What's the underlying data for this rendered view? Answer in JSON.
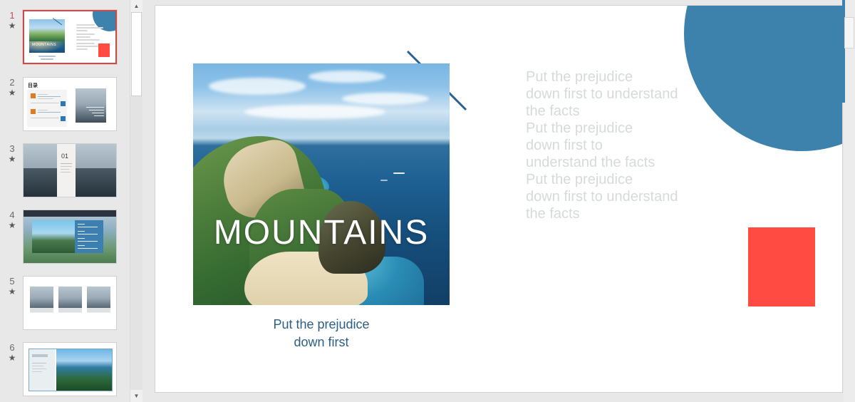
{
  "app": {
    "name": "presentation-editor",
    "accent_blue": "#3c82ad",
    "accent_red": "#ff4b42",
    "caption_blue": "#2c5f86",
    "body_text_gray": "#d6dadd",
    "selection_border": "#c0504d",
    "canvas_bg": "#ffffff",
    "workspace_bg": "#e8e8e8"
  },
  "thumbnail_panel": {
    "name": "slide-thumbnail-panel",
    "animation_marker": "★",
    "slides": [
      {
        "number": "1",
        "star": "★",
        "selected": true,
        "title": "title-slide-mountains"
      },
      {
        "number": "2",
        "star": "★",
        "selected": false,
        "title": "contents-slide",
        "heading": "目录"
      },
      {
        "number": "3",
        "star": "★",
        "selected": false,
        "title": "section-divider-01",
        "heading": "01"
      },
      {
        "number": "4",
        "star": "★",
        "selected": false,
        "title": "image-with-list-slide"
      },
      {
        "number": "5",
        "star": "★",
        "selected": false,
        "title": "three-image-gallery-slide"
      },
      {
        "number": "6",
        "star": "★",
        "selected": false,
        "title": "text-and-image-slide"
      }
    ]
  },
  "panel_scrollbar": {
    "name": "thumbnail-scrollbar",
    "up_arrow": "▲",
    "down_arrow": "▼"
  },
  "slide": {
    "name": "active-slide-canvas",
    "title": "MOUNTAINS",
    "caption_line1": "Put the prejudice",
    "caption_line2": "down first",
    "body_lines": [
      "Put the prejudice",
      "down first to understand",
      "the facts",
      "Put the prejudice",
      "down first to",
      "understand the facts",
      "Put the prejudice",
      "down first to understand",
      "the facts"
    ],
    "photo_alt": "coastal-cliffs-and-sea-photo",
    "decorations": {
      "circle": "blue-quarter-circle",
      "rectangle": "red-rectangle",
      "diagonal": "blue-diagonal-line"
    }
  },
  "right_scrollbar": {
    "name": "workspace-vertical-scrollbar"
  }
}
